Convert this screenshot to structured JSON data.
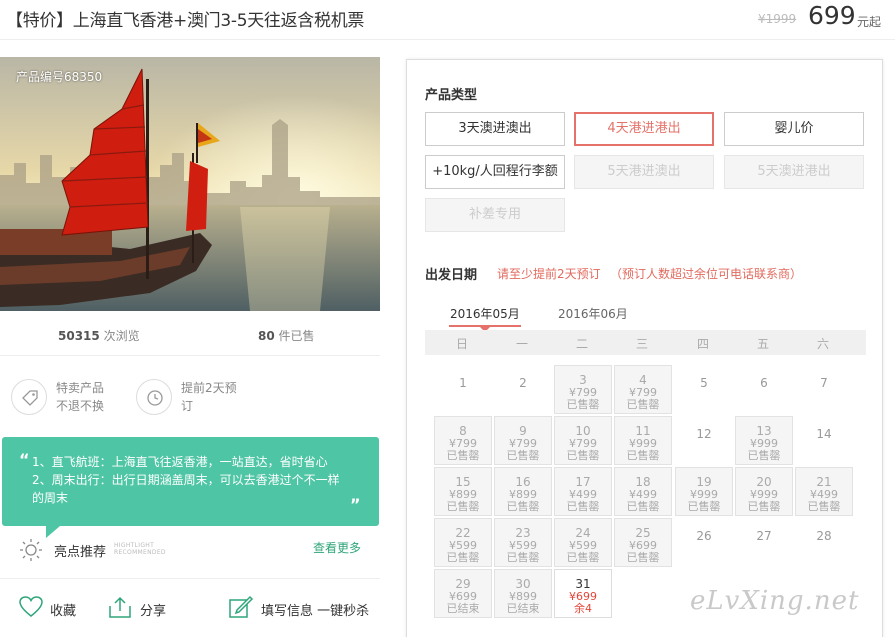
{
  "header": {
    "title": "【特价】上海直飞香港+澳门3-5天往返含税机票",
    "old_price": "¥1999",
    "price": "699",
    "price_unit": "元起"
  },
  "product": {
    "id_label": "产品编号68350",
    "views_count": "50315",
    "views_label": "次浏览",
    "sold_count": "80",
    "sold_label": "件已售"
  },
  "features": [
    {
      "icon": "tag-icon",
      "line1": "特卖产品",
      "line2": "不退不换"
    },
    {
      "icon": "clock-icon",
      "line1": "提前2天预",
      "line2": "订"
    }
  ],
  "highlight": {
    "line1": "1、直飞航班：上海直飞往返香港，一站直达，省时省心",
    "line2": "2、周末出行：出行日期涵盖周末，可以去香港过个不一样",
    "line3": "的周末",
    "label": "亮点推荐",
    "en1": "HIGHTLIGHT",
    "en2": "RECOMMENDED",
    "more": "查看更多"
  },
  "actions": {
    "collect": "收藏",
    "share": "分享",
    "fill": "填写信息 一键秒杀"
  },
  "booking": {
    "type_heading": "产品类型",
    "types": [
      {
        "label": "3天澳进澳出",
        "state": "normal"
      },
      {
        "label": "4天港进港出",
        "state": "selected"
      },
      {
        "label": "婴儿价",
        "state": "normal"
      },
      {
        "label": "+10kg/人回程行李额",
        "state": "normal"
      },
      {
        "label": "5天港进澳出",
        "state": "disabled"
      },
      {
        "label": "5天澳进港出",
        "state": "disabled"
      },
      {
        "label": "补差专用",
        "state": "disabled"
      }
    ],
    "date_heading": "出发日期",
    "note1": "请至少提前2天预订",
    "note2": "（预订人数超过余位可电话联系商）",
    "months": [
      "2016年05月",
      "2016年06月"
    ],
    "weekdays": [
      "日",
      "一",
      "二",
      "三",
      "四",
      "五",
      "六"
    ],
    "days": [
      {
        "d": "1",
        "s": "plain"
      },
      {
        "d": "2",
        "s": "plain"
      },
      {
        "d": "3",
        "p": "¥799",
        "t": "已售罄",
        "s": "box"
      },
      {
        "d": "4",
        "p": "¥799",
        "t": "已售罄",
        "s": "box"
      },
      {
        "d": "5",
        "s": "plain"
      },
      {
        "d": "6",
        "s": "plain"
      },
      {
        "d": "7",
        "s": "plain"
      },
      {
        "d": "8",
        "p": "¥799",
        "t": "已售罄",
        "s": "box"
      },
      {
        "d": "9",
        "p": "¥799",
        "t": "已售罄",
        "s": "box"
      },
      {
        "d": "10",
        "p": "¥799",
        "t": "已售罄",
        "s": "box"
      },
      {
        "d": "11",
        "p": "¥999",
        "t": "已售罄",
        "s": "box"
      },
      {
        "d": "12",
        "s": "plain"
      },
      {
        "d": "13",
        "p": "¥999",
        "t": "已售罄",
        "s": "box"
      },
      {
        "d": "14",
        "s": "plain"
      },
      {
        "d": "15",
        "p": "¥899",
        "t": "已售罄",
        "s": "box"
      },
      {
        "d": "16",
        "p": "¥899",
        "t": "已售罄",
        "s": "box"
      },
      {
        "d": "17",
        "p": "¥499",
        "t": "已售罄",
        "s": "box"
      },
      {
        "d": "18",
        "p": "¥499",
        "t": "已售罄",
        "s": "box"
      },
      {
        "d": "19",
        "p": "¥999",
        "t": "已售罄",
        "s": "box"
      },
      {
        "d": "20",
        "p": "¥999",
        "t": "已售罄",
        "s": "box"
      },
      {
        "d": "21",
        "p": "¥499",
        "t": "已售罄",
        "s": "box"
      },
      {
        "d": "22",
        "p": "¥599",
        "t": "已售罄",
        "s": "box"
      },
      {
        "d": "23",
        "p": "¥599",
        "t": "已售罄",
        "s": "box"
      },
      {
        "d": "24",
        "p": "¥599",
        "t": "已售罄",
        "s": "box"
      },
      {
        "d": "25",
        "p": "¥699",
        "t": "已售罄",
        "s": "box"
      },
      {
        "d": "26",
        "s": "plain"
      },
      {
        "d": "27",
        "s": "plain"
      },
      {
        "d": "28",
        "s": "plain"
      },
      {
        "d": "29",
        "p": "¥699",
        "t": "已结束",
        "s": "box"
      },
      {
        "d": "30",
        "p": "¥899",
        "t": "已结束",
        "s": "box"
      },
      {
        "d": "31",
        "p": "¥699",
        "t": "余4",
        "s": "avail"
      }
    ]
  },
  "watermark": "eLvXing.net"
}
